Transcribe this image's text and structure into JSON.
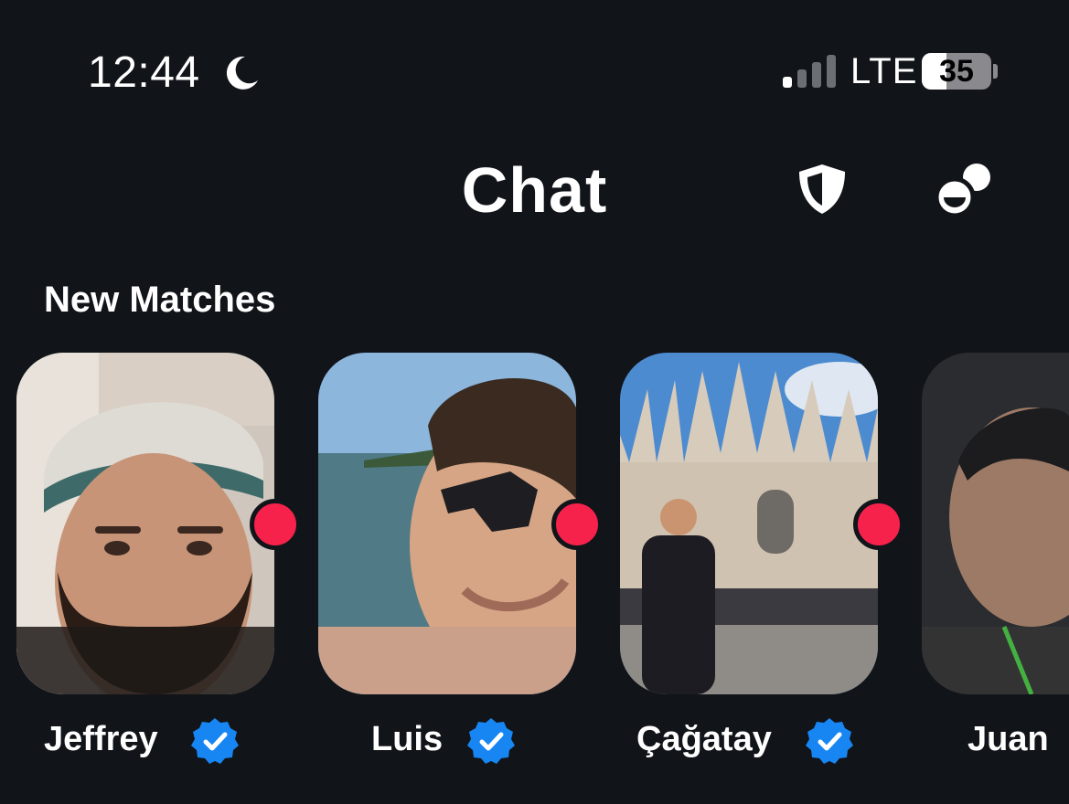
{
  "status_bar": {
    "time": "12:44",
    "network": "LTE",
    "battery": "35",
    "battery_percent": 35,
    "icons": [
      "moon-icon",
      "signal-icon",
      "battery-icon"
    ]
  },
  "header": {
    "title": "Chat",
    "icons": [
      "shield-icon",
      "people-icon"
    ]
  },
  "new_matches": {
    "title": "New Matches",
    "items": [
      {
        "name": "Jeffrey",
        "verified": true,
        "unread": true
      },
      {
        "name": "Luis",
        "verified": true,
        "unread": true
      },
      {
        "name": "Çağatay",
        "verified": true,
        "unread": true
      },
      {
        "name": "Juan",
        "verified": false,
        "unread": false
      }
    ]
  },
  "colors": {
    "background": "#111419",
    "accent_dot": "#f6224c",
    "verified_badge": "#1786f2"
  }
}
